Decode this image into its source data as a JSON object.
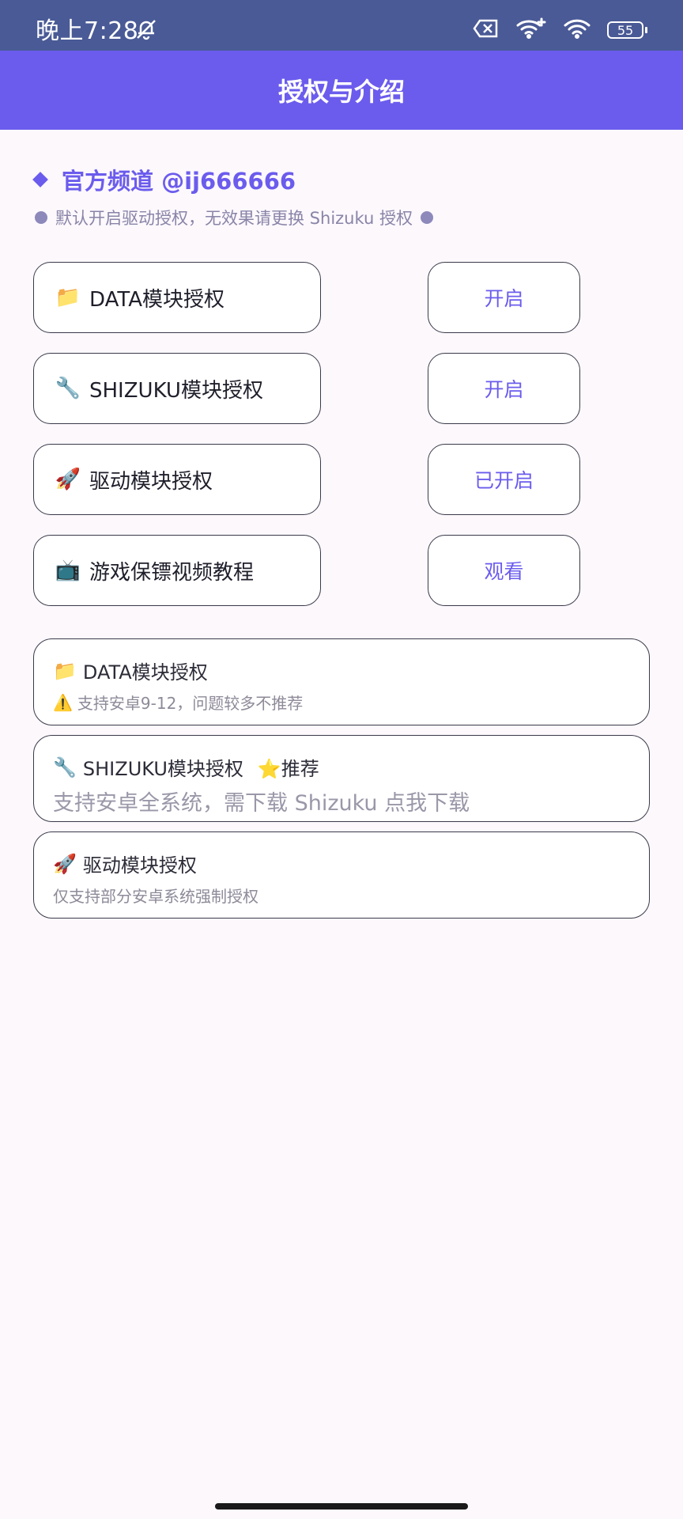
{
  "status_bar": {
    "time": "晚上7:28",
    "battery": "55",
    "icons": [
      "bell-off-icon",
      "sim-off-icon",
      "wifi-plus-icon",
      "wifi-icon",
      "battery-icon"
    ]
  },
  "app_bar": {
    "title": "授权与介绍"
  },
  "header": {
    "channel": "官方频道 @ij666666",
    "notice": "默认开启驱动授权，无效果请更换 Shizuku 授权"
  },
  "rows": [
    {
      "icon": "📁",
      "label": "DATA模块授权",
      "action": "开启"
    },
    {
      "icon": "🔧",
      "label": "SHIZUKU模块授权",
      "action": "开启"
    },
    {
      "icon": "🚀",
      "label": "驱动模块授权",
      "action": "已开启"
    },
    {
      "icon": "📺",
      "label": "游戏保镖视频教程",
      "action": "观看"
    }
  ],
  "cards": [
    {
      "icon": "📁",
      "title": "DATA模块授权",
      "badge_icon": "⚠️",
      "subtitle": "支持安卓9-12，问题较多不推荐"
    },
    {
      "icon": "🔧",
      "title": "SHIZUKU模块授权",
      "badge": "⭐推荐",
      "subtitle": "支持安卓全系统，需下载 Shizuku 点我下载"
    },
    {
      "icon": "🚀",
      "title": "驱动模块授权",
      "subtitle": "仅支持部分安卓系统强制授权"
    }
  ],
  "colors": {
    "accent": "#6b5ced",
    "status_bar": "#4a5a96",
    "background": "#fcf8fc"
  }
}
